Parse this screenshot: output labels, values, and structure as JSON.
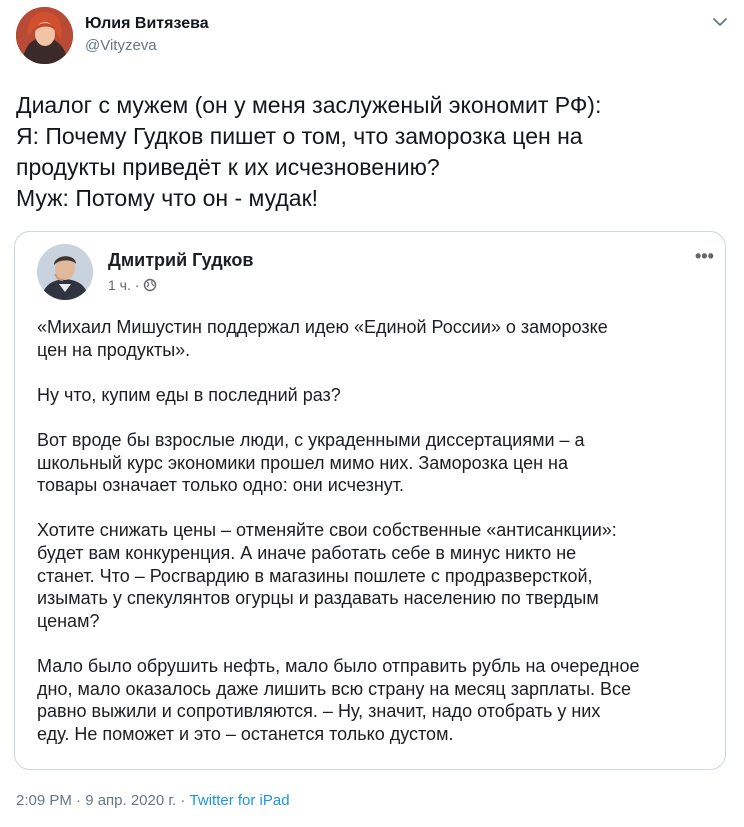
{
  "author": {
    "name": "Юлия Витязева",
    "handle": "@Vityzeva"
  },
  "tweet": {
    "lines": [
      "Диалог с мужем (он у меня заслуженый экономит РФ):",
      "Я: Почему Гудков пишет о том, что заморозка цен на",
      "продукты приведёт к их исчезновению?",
      "Муж: Потому что он - мудак!"
    ]
  },
  "embedded_post": {
    "author_name": "Дмитрий Гудков",
    "time": "1 ч. ·",
    "more_label": "•••",
    "paragraphs": [
      [
        "«Михаил Мишустин поддержал идею «Единой России» о заморозке",
        "цен на продукты»."
      ],
      [
        "Ну что, купим еды в последний раз?"
      ],
      [
        "Вот вроде бы взрослые люди, с украденными диссертациями – а",
        "школьный курс экономики прошел мимо них. Заморозка цен на",
        "товары означает только одно: они исчезнут."
      ],
      [
        "Хотите снижать цены – отменяйте свои собственные «антисанкции»:",
        "будет вам конкуренция. А иначе работать себе в минус никто не",
        "станет. Что – Росгвардию в магазины пошлете с продразверсткой,",
        "изымать у спекулянтов огурцы и раздавать населению по твердым",
        "ценам?"
      ],
      [
        "Мало было обрушить нефть, мало было отправить рубль на очередное",
        "дно, мало оказалось даже лишить всю страну на месяц зарплаты. Все",
        "равно выжили и сопротивляются. – Ну, значит, надо отобрать у них",
        "еду. Не поможет и это – останется только дустом."
      ]
    ]
  },
  "footer": {
    "time": "2:09 PM · 9 апр. 2020 г. · ",
    "source": "Twitter for iPad"
  },
  "icons": {
    "caret": "chevron-down-icon",
    "globe": "globe-icon",
    "more": "more-horizontal-icon"
  },
  "colors": {
    "text": "#14171a",
    "secondary": "#657786",
    "link": "#1b95e0",
    "border": "#ccd6dd"
  }
}
